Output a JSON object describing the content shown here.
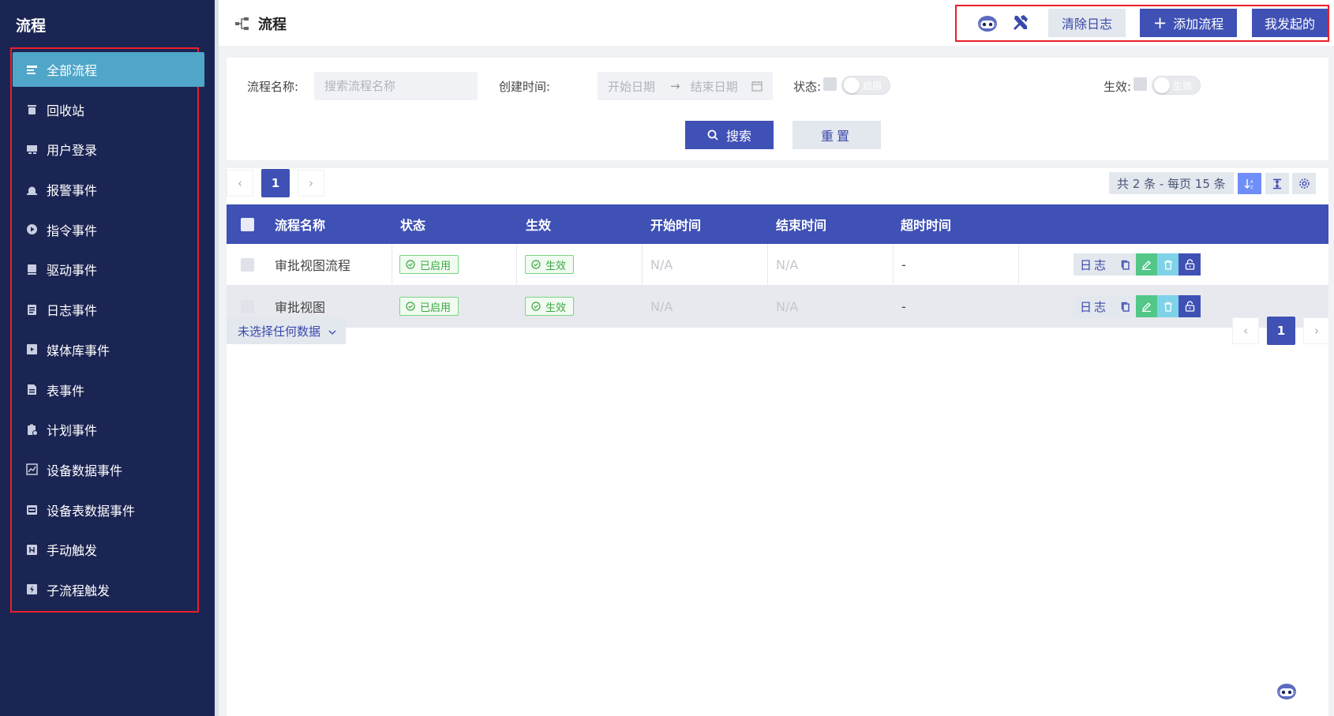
{
  "sidebar": {
    "title": "流程",
    "items": [
      {
        "label": "全部流程",
        "icon": "list-flow-icon",
        "active": true
      },
      {
        "label": "回收站",
        "icon": "trash-icon"
      },
      {
        "label": "用户登录",
        "icon": "user-card-icon"
      },
      {
        "label": "报警事件",
        "icon": "alarm-icon"
      },
      {
        "label": "指令事件",
        "icon": "play-circle-icon"
      },
      {
        "label": "驱动事件",
        "icon": "drive-icon"
      },
      {
        "label": "日志事件",
        "icon": "log-icon"
      },
      {
        "label": "媒体库事件",
        "icon": "media-icon"
      },
      {
        "label": "表事件",
        "icon": "sheet-icon"
      },
      {
        "label": "计划事件",
        "icon": "plan-icon"
      },
      {
        "label": "设备数据事件",
        "icon": "chart-icon"
      },
      {
        "label": "设备表数据事件",
        "icon": "device-table-icon"
      },
      {
        "label": "手动触发",
        "icon": "manual-icon"
      },
      {
        "label": "子流程触发",
        "icon": "bolt-icon"
      }
    ]
  },
  "header": {
    "title": "流程",
    "clear_log": "清除日志",
    "add_flow": "添加流程",
    "my_started": "我发起的"
  },
  "filters": {
    "name_label": "流程名称:",
    "name_placeholder": "搜索流程名称",
    "created_label": "创建时间:",
    "start_date": "开始日期",
    "end_date": "结束日期",
    "status_label": "状态:",
    "status_toggle": "启用",
    "effect_label": "生效:",
    "effect_toggle": "生效",
    "search": "搜索",
    "reset": "重置"
  },
  "pagination": {
    "current_page": "1",
    "summary": "共 2 条 - 每页 15 条"
  },
  "table": {
    "columns": [
      "流程名称",
      "状态",
      "生效",
      "开始时间",
      "结束时间",
      "超时时间"
    ],
    "rows": [
      {
        "name": "审批视图流程",
        "status": "已启用",
        "effect": "生效",
        "start": "N/A",
        "end": "N/A",
        "timeout": "-",
        "log": "日志"
      },
      {
        "name": "审批视图",
        "status": "已启用",
        "effect": "生效",
        "start": "N/A",
        "end": "N/A",
        "timeout": "-",
        "log": "日志"
      }
    ]
  },
  "bottom": {
    "selection": "未选择任何数据"
  },
  "colors": {
    "sidebar_bg": "#1b2553",
    "active_item": "#4fa6c8",
    "primary": "#3f51b5",
    "success": "#3aa83f",
    "highlight_frame": "#e8202a"
  }
}
